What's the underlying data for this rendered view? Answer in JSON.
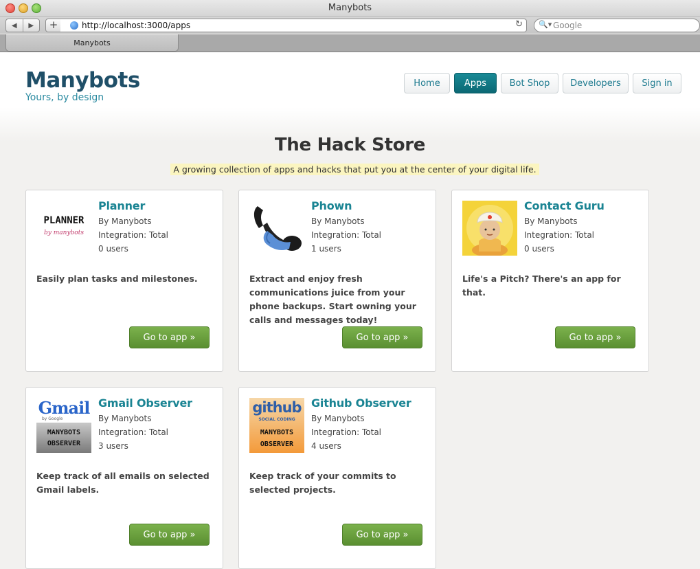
{
  "browser": {
    "window_title": "Manybots",
    "url": "http://localhost:3000/apps",
    "search_placeholder": "Google",
    "tab_title": "Manybots",
    "back_glyph": "◀",
    "forward_glyph": "▶",
    "plus_glyph": "+",
    "reload_glyph": "↻",
    "search_glyph": "🔍▾",
    "tab_close_glyph": ""
  },
  "header": {
    "brand": "Manybots",
    "tagline": "Yours, by design"
  },
  "nav": {
    "items": [
      {
        "label": "Home"
      },
      {
        "label": "Apps",
        "active": true
      },
      {
        "label": "Bot Shop"
      },
      {
        "label": "Developers"
      },
      {
        "label": "Sign in"
      }
    ]
  },
  "store": {
    "title": "The Hack Store",
    "subtitle": "A growing collection of apps and hacks that put you at the center of your digital life."
  },
  "apps": [
    {
      "name": "Planner",
      "author": "By Manybots",
      "integration": "Integration: Total",
      "users": "0 users",
      "description": "Easily plan tasks and milestones.",
      "button": "Go to app »",
      "icon": "planner-logo",
      "logo_text": "PLANNER",
      "logo_sub": "by manybots"
    },
    {
      "name": "Phown",
      "author": "By Manybots",
      "integration": "Integration: Total",
      "users": "1 users",
      "description": "Extract and enjoy fresh communications juice from your phone backups. Start owning your calls and messages today!",
      "button": "Go to app »",
      "icon": "phone-icon"
    },
    {
      "name": "Contact Guru",
      "author": "By Manybots",
      "integration": "Integration: Total",
      "users": "0 users",
      "description": "Life's a Pitch? There's an app for that.",
      "button": "Go to app »",
      "icon": "guru-icon"
    },
    {
      "name": "Gmail Observer",
      "author": "By Manybots",
      "integration": "Integration: Total",
      "users": "3 users",
      "description": "Keep track of all emails on selected Gmail labels.",
      "button": "Go to app »",
      "icon": "gmail-observer-logo",
      "logo_text": "Gmail",
      "logo_sub": "by Google",
      "badge_text_1": "MANYBOTS",
      "badge_text_2": "OBSERVER"
    },
    {
      "name": "Github Observer",
      "author": "By Manybots",
      "integration": "Integration: Total",
      "users": "4 users",
      "description": "Keep track of your commits to selected projects.",
      "button": "Go to app »",
      "icon": "github-observer-logo",
      "logo_text": "github",
      "logo_sub": "SOCIAL CODING",
      "badge_text_1": "MANYBOTS",
      "badge_text_2": "OBSERVER"
    }
  ],
  "colors": {
    "brand": "#1f4f68",
    "accent": "#1a8493",
    "active_nav": "#0b6874",
    "go_button": "#6aa03e",
    "highlight": "#fbf5c0"
  }
}
